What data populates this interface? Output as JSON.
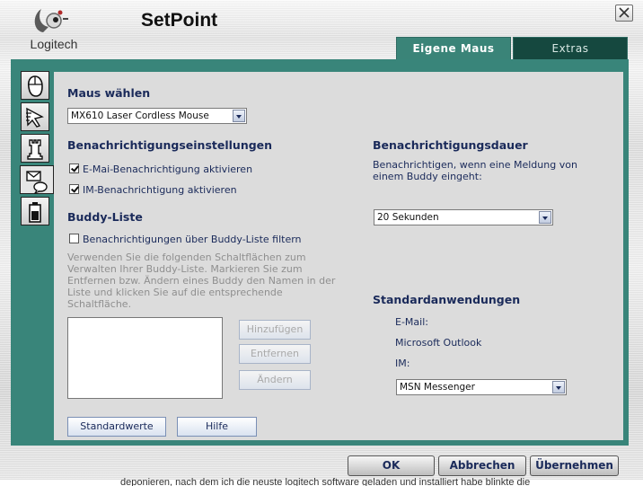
{
  "window": {
    "app_title": "SetPoint",
    "logo_text": "Logitech",
    "close_label": "close"
  },
  "tabs": [
    {
      "label": "Eigene Maus",
      "active": true
    },
    {
      "label": "Extras",
      "active": false
    }
  ],
  "sidebar": {
    "items": [
      {
        "icon": "mouse-icon"
      },
      {
        "icon": "pointer-icon"
      },
      {
        "icon": "chess-rook-icon"
      },
      {
        "icon": "messenger-icon",
        "active": true
      },
      {
        "icon": "battery-icon"
      }
    ]
  },
  "mouse_section": {
    "heading": "Maus wählen",
    "selected": "MX610 Laser Cordless Mouse"
  },
  "notifications": {
    "heading": "Benachrichtigungseinstellungen",
    "email_label": "E-Mai-Benachrichtigung aktivieren",
    "email_checked": true,
    "im_label": "IM-Benachrichtigung aktivieren",
    "im_checked": true
  },
  "duration": {
    "heading": "Benachrichtigungsdauer",
    "description": "Benachrichtigen, wenn eine Meldung von einem Buddy eingeht:",
    "selected": "20 Sekunden"
  },
  "buddy": {
    "heading": "Buddy-Liste",
    "filter_label": "Benachrichtigungen über Buddy-Liste filtern",
    "filter_checked": false,
    "help_text": "Verwenden Sie die folgenden Schaltflächen zum Verwalten Ihrer Buddy-Liste. Markieren Sie zum Entfernen bzw. Ändern eines Buddy den Namen in der Liste und klicken Sie auf die entsprechende Schaltfläche.",
    "add_label": "Hinzufügen",
    "remove_label": "Entfernen",
    "change_label": "Ändern"
  },
  "defaults": {
    "heading": "Standardanwendungen",
    "email_label": "E-Mail:",
    "email_app": "Microsoft Outlook",
    "im_label": "IM:",
    "im_app": "MSN Messenger"
  },
  "panel_buttons": {
    "defaults_label": "Standardwerte",
    "help_label": "Hilfe"
  },
  "dialog_buttons": {
    "ok_label": "OK",
    "cancel_label": "Abbrechen",
    "apply_label": "Übernehmen"
  },
  "background_text": "deponieren, nach dem ich die neuste logitech software geladen und installiert habe blinkte die"
}
